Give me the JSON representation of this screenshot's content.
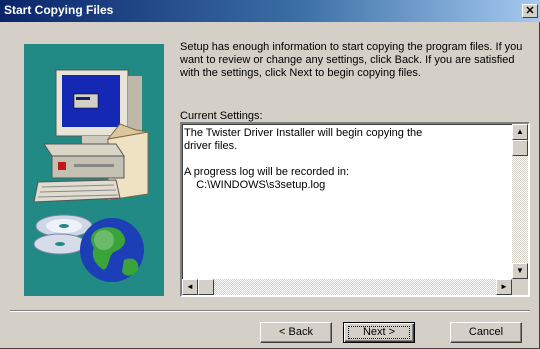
{
  "window": {
    "title": "Start Copying Files",
    "close_glyph": "✕"
  },
  "intro_text": "Setup has enough information to start copying the program files.  If you want to review or change any settings, click Back.  If you are satisfied with the settings, click Next to begin copying files.",
  "current_settings": {
    "label": "Current Settings:",
    "content": "The Twister Driver Installer will begin copying the\ndriver files.\n\nA progress log will be recorded in:\n    C:\\WINDOWS\\s3setup.log"
  },
  "buttons": {
    "back_label": "< Back",
    "next_label": "Next >",
    "cancel_label": "Cancel"
  },
  "icons": [
    "computer-icon",
    "cd-icon",
    "globe-icon",
    "close-icon",
    "scroll-up-icon",
    "scroll-down-icon",
    "scroll-left-icon",
    "scroll-right-icon"
  ],
  "colors": {
    "titlebar_start": "#0a246a",
    "titlebar_end": "#a6caf0",
    "panel_teal": "#218a84",
    "dialog_face": "#d4d0c8"
  }
}
